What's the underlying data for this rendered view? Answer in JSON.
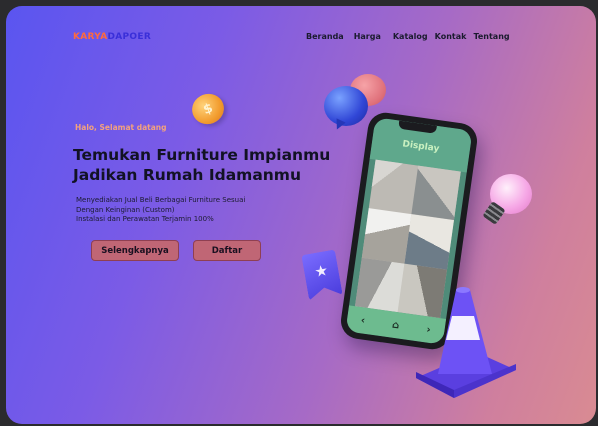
{
  "brand": {
    "part1": "KARYA",
    "part2": "DAPOER"
  },
  "nav": {
    "items": [
      "Beranda",
      "Harga",
      "Katalog",
      "Kontak",
      "Tentang"
    ]
  },
  "hero": {
    "greeting": "Halo, Selamat datang",
    "title_line1": "Temukan Furniture Impianmu",
    "title_line2": "Jadikan Rumah Idamanmu",
    "desc_line1": "Menyediakan Jual Beli Berbagai Furniture Sesuai",
    "desc_line2": "Dengan Keinginan (Custom)",
    "desc_line3": "Instalasi dan Perawatan Terjamin 100%",
    "button_primary": "Selengkapnya",
    "button_secondary": "Daftar"
  },
  "phone": {
    "screen_label": "Display",
    "nav_left": "‹",
    "nav_home": "⌂",
    "nav_right": "›"
  },
  "icons": {
    "coin_symbol": "$",
    "badge_symbol": "★"
  },
  "colors": {
    "brand_accent": "#ff6a3d",
    "brand_primary": "#3a2fd9",
    "button": "#c06675"
  }
}
